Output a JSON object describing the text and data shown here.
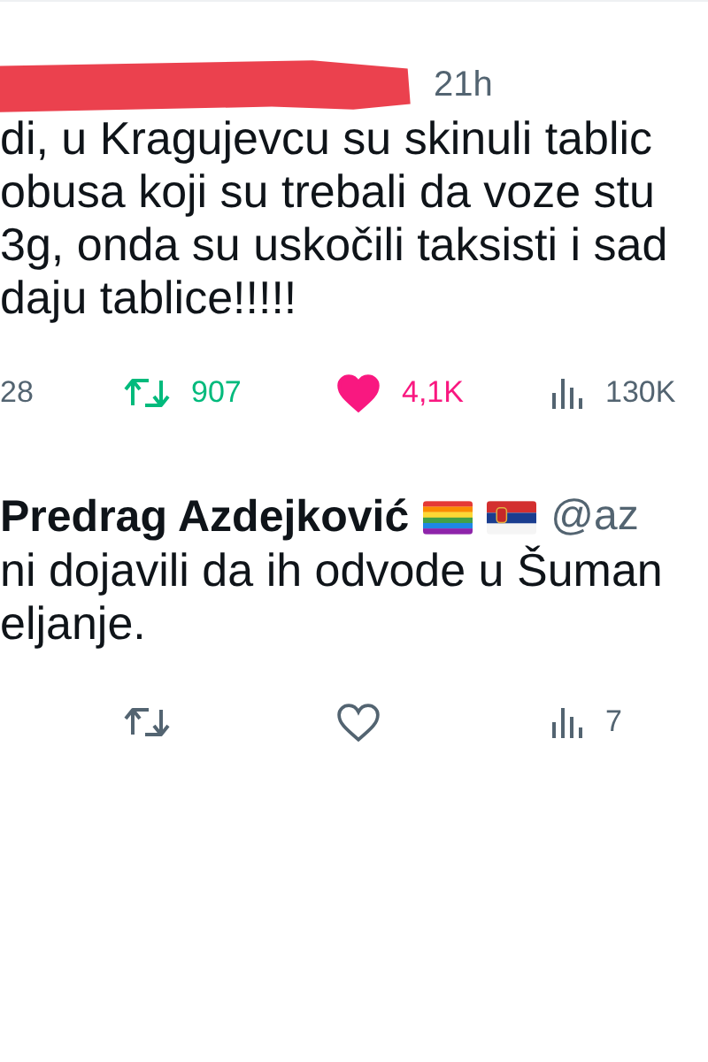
{
  "tweets": [
    {
      "time": "21h",
      "redacted": true,
      "lines": [
        "di, u Kragujevcu su skinuli tablic",
        "obusa koji su trebali da voze stu",
        "3g, onda su uskočili taksisti i sad",
        "daju tablice!!!!!"
      ],
      "replies": "28",
      "reposts": "907",
      "likes": "4,1K",
      "views": "130K",
      "reposted": true,
      "liked": true
    },
    {
      "name": "Predrag Azdejković",
      "handle": "@az",
      "lines": [
        "ni dojavili da ih odvode u Šuman",
        "eljanje."
      ],
      "views": "7",
      "reposted": false,
      "liked": false
    }
  ]
}
